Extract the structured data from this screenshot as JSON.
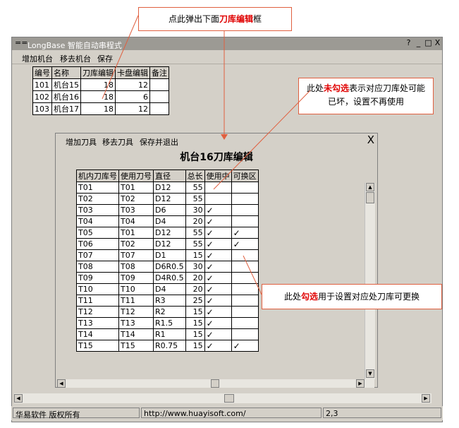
{
  "window": {
    "title": "LongBase 智能自动串程式",
    "help": "?",
    "min": "_",
    "max": "□",
    "close": "X"
  },
  "menu": [
    "增加机台",
    "移去机台",
    "保存"
  ],
  "machines": {
    "headers": [
      "编号",
      "名称",
      "刀库编辑",
      "卡盘编辑",
      "备注"
    ],
    "rows": [
      [
        "101",
        "机台15",
        "18",
        "12",
        ""
      ],
      [
        "102",
        "机台16",
        "18",
        "6",
        ""
      ],
      [
        "103",
        "机台17",
        "18",
        "12",
        ""
      ]
    ]
  },
  "dialog": {
    "menu": [
      "增加刀具",
      "移去刀具",
      "保存并退出"
    ],
    "close": "X",
    "title": "机台16刀库编辑",
    "headers": [
      "机内刀库号",
      "使用刀号",
      "直径",
      "总长",
      "使用中",
      "可换区"
    ],
    "rows": [
      [
        "T01",
        "T01",
        "D12",
        "55",
        false,
        false
      ],
      [
        "T02",
        "T02",
        "D12",
        "55",
        false,
        false
      ],
      [
        "T03",
        "T03",
        "D6",
        "30",
        true,
        false
      ],
      [
        "T04",
        "T04",
        "D4",
        "20",
        true,
        false
      ],
      [
        "T05",
        "T01",
        "D12",
        "55",
        true,
        true
      ],
      [
        "T06",
        "T02",
        "D12",
        "55",
        true,
        true
      ],
      [
        "T07",
        "T07",
        "D1",
        "15",
        true,
        false
      ],
      [
        "T08",
        "T08",
        "D6R0.5",
        "30",
        true,
        false
      ],
      [
        "T09",
        "T09",
        "D4R0.5",
        "20",
        true,
        false
      ],
      [
        "T10",
        "T10",
        "D4",
        "20",
        true,
        false
      ],
      [
        "T11",
        "T11",
        "R3",
        "25",
        true,
        false
      ],
      [
        "T12",
        "T12",
        "R2",
        "15",
        true,
        false
      ],
      [
        "T13",
        "T13",
        "R1.5",
        "15",
        true,
        false
      ],
      [
        "T14",
        "T14",
        "R1",
        "15",
        true,
        false
      ],
      [
        "T15",
        "T15",
        "R0.75",
        "15",
        true,
        true
      ]
    ],
    "check_glyph": "✓"
  },
  "status": {
    "company": "华易软件 版权所有",
    "url": "http://www.huayisoft.com/",
    "pos": "2,3"
  },
  "callouts": {
    "top_pre": "点此弹出下面",
    "top_bold": "刀库编辑",
    "top_post": "框",
    "uncheck_pre": "此处",
    "uncheck_bold": "未勾选",
    "uncheck_post": "表示对应刀库处可能已坏，设置不再使用",
    "check_pre": "此处",
    "check_bold": "勾选",
    "check_post": "用于设置对应处刀库可更换"
  },
  "colors": {
    "callout_border": "#e06040",
    "callout_text_emphasis": "#e00000",
    "window_bg": "#d4d0c8"
  }
}
